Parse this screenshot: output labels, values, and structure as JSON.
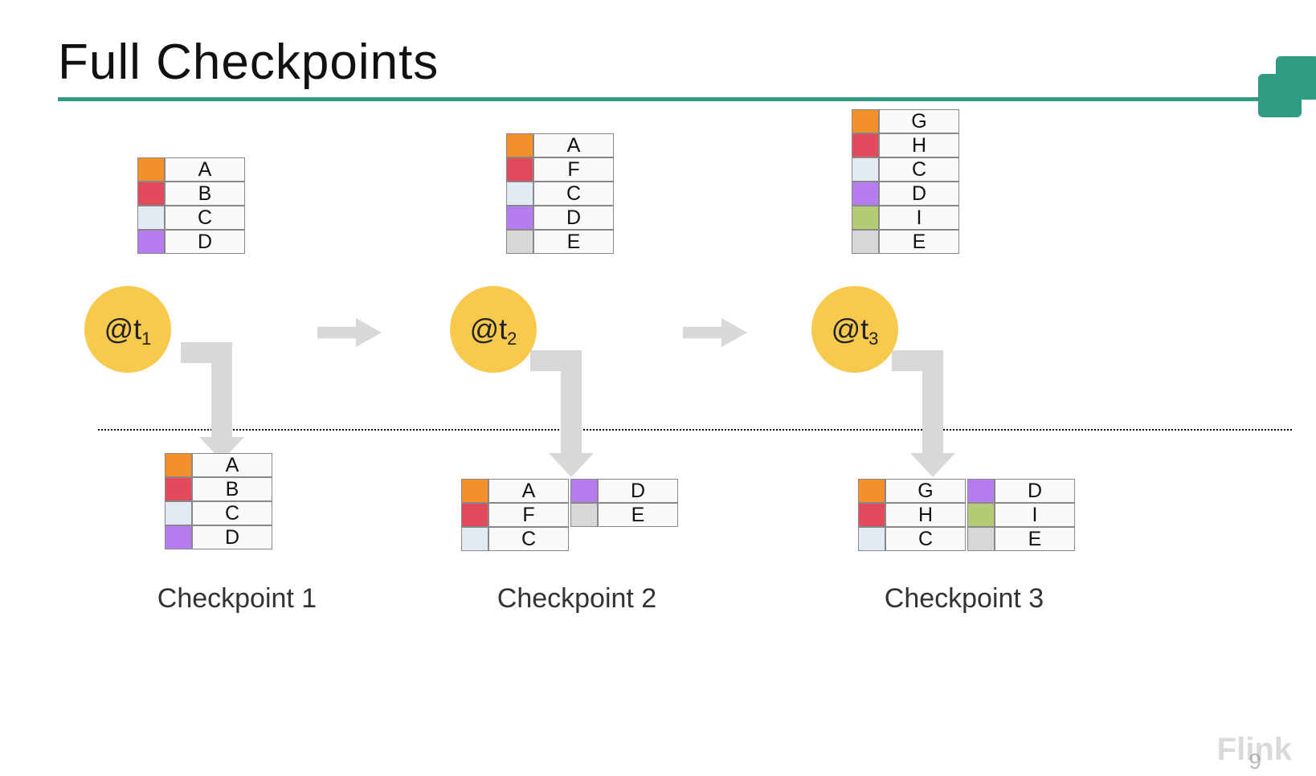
{
  "title": "Full Checkpoints",
  "colors": {
    "orange": "#f3902a",
    "red": "#e44a5e",
    "lightblue": "#e2eaf3",
    "purple": "#b77df0",
    "grey": "#d7d7d7",
    "olive": "#b4cb76",
    "accent": "#2e9c82",
    "ball": "#f7c94d"
  },
  "timepoints": [
    {
      "label_main": "@t",
      "label_sub": "1"
    },
    {
      "label_main": "@t",
      "label_sub": "2"
    },
    {
      "label_main": "@t",
      "label_sub": "3"
    }
  ],
  "states": {
    "t1": [
      {
        "c": "orange",
        "v": "A"
      },
      {
        "c": "redish",
        "v": "B"
      },
      {
        "c": "lightblue",
        "v": "C"
      },
      {
        "c": "purple",
        "v": "D"
      }
    ],
    "t2": [
      {
        "c": "orange",
        "v": "A"
      },
      {
        "c": "redish",
        "v": "F"
      },
      {
        "c": "lightblue",
        "v": "C"
      },
      {
        "c": "purple",
        "v": "D"
      },
      {
        "c": "grey",
        "v": "E"
      }
    ],
    "t3": [
      {
        "c": "orange",
        "v": "G"
      },
      {
        "c": "redish",
        "v": "H"
      },
      {
        "c": "lightblue",
        "v": "C"
      },
      {
        "c": "purple",
        "v": "D"
      },
      {
        "c": "olive",
        "v": "I"
      },
      {
        "c": "grey",
        "v": "E"
      }
    ]
  },
  "checkpoints": {
    "cp1": {
      "label": "Checkpoint 1",
      "blocks": [
        [
          {
            "c": "orange",
            "v": "A"
          },
          {
            "c": "redish",
            "v": "B"
          },
          {
            "c": "lightblue",
            "v": "C"
          },
          {
            "c": "purple",
            "v": "D"
          }
        ]
      ]
    },
    "cp2": {
      "label": "Checkpoint 2",
      "blocks": [
        [
          {
            "c": "orange",
            "v": "A"
          },
          {
            "c": "redish",
            "v": "F"
          },
          {
            "c": "lightblue",
            "v": "C"
          }
        ],
        [
          {
            "c": "purple",
            "v": "D"
          },
          {
            "c": "grey",
            "v": "E"
          }
        ]
      ]
    },
    "cp3": {
      "label": "Checkpoint 3",
      "blocks": [
        [
          {
            "c": "orange",
            "v": "G"
          },
          {
            "c": "redish",
            "v": "H"
          },
          {
            "c": "lightblue",
            "v": "C"
          }
        ],
        [
          {
            "c": "purple",
            "v": "D"
          },
          {
            "c": "olive",
            "v": "I"
          },
          {
            "c": "grey",
            "v": "E"
          }
        ]
      ]
    }
  },
  "watermark": "Flink",
  "pageno": "9"
}
